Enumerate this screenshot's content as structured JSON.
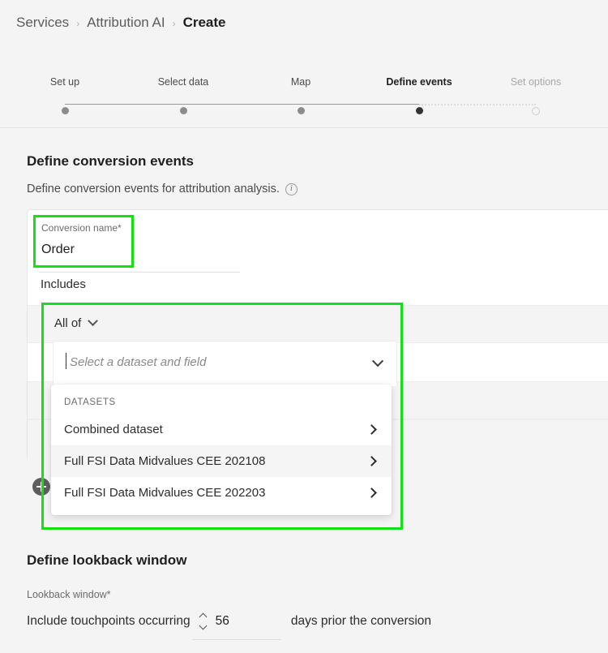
{
  "breadcrumb": {
    "items": [
      {
        "label": "Services",
        "current": false
      },
      {
        "label": "Attribution AI",
        "current": false
      },
      {
        "label": "Create",
        "current": true
      }
    ],
    "separator": "›"
  },
  "stepper": {
    "steps": [
      {
        "label": "Set up",
        "state": "done"
      },
      {
        "label": "Select data",
        "state": "done"
      },
      {
        "label": "Map",
        "state": "done"
      },
      {
        "label": "Define events",
        "state": "current"
      },
      {
        "label": "Set options",
        "state": "future"
      }
    ]
  },
  "define_events": {
    "title": "Define conversion events",
    "subtitle": "Define conversion events for attribution analysis.",
    "info_icon": "info-icon",
    "conversion_name": {
      "label": "Conversion name*",
      "value": "Order"
    },
    "includes_label": "Includes",
    "condition_group": {
      "operator_label": "All of",
      "operator_icon": "chevron-down-icon",
      "field_select": {
        "placeholder": "Select a dataset and field",
        "value": "",
        "icon": "chevron-down-icon"
      }
    },
    "add_button_icon": "plus-icon"
  },
  "dataset_dropdown": {
    "group_header": "DATASETS",
    "items": [
      {
        "label": "Combined dataset",
        "icon": "chevron-right-icon",
        "hovered": false
      },
      {
        "label": "Full FSI Data Midvalues CEE 202108",
        "icon": "chevron-right-icon",
        "hovered": true
      },
      {
        "label": "Full FSI Data Midvalues CEE 202203",
        "icon": "chevron-right-icon",
        "hovered": false
      }
    ]
  },
  "lookback": {
    "title": "Define lookback window",
    "label": "Lookback window*",
    "prefix_text": "Include touchpoints occurring",
    "value": "56",
    "suffix_text": "days prior the conversion",
    "stepper_up_icon": "chevron-up-icon",
    "stepper_down_icon": "chevron-down-icon"
  },
  "highlights": {
    "color": "#15e015",
    "regions": [
      "conversion-name-field",
      "all-of-condition-group"
    ]
  }
}
